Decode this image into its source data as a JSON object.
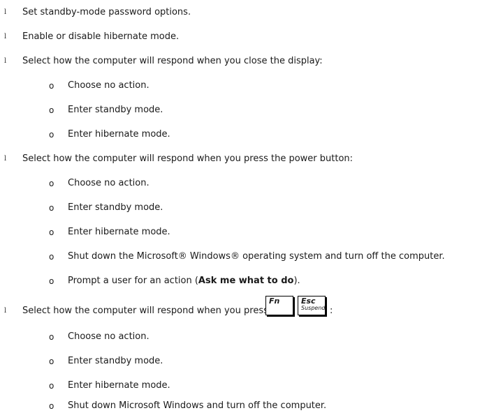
{
  "bullet_glyph": "l",
  "sub_bullet_glyph": "o",
  "items": [
    {
      "text": "Set standby-mode password options."
    },
    {
      "text": "Enable or disable hibernate mode."
    },
    {
      "text": "Select how the computer will respond when you close the display:"
    },
    {
      "sub": [
        "Choose no action.",
        "Enter standby mode.",
        "Enter hibernate mode."
      ]
    },
    {
      "text": "Select how the computer will respond when you press the power button:"
    },
    {
      "sub": [
        "Choose no action.",
        "Enter standby mode.",
        "Enter hibernate mode.",
        "Shut down the Microsoft® Windows® operating system and turn off the computer."
      ]
    },
    {
      "prompt_before": "Prompt a user for an action (",
      "prompt_bold": "Ask me what to do",
      "prompt_after": ")."
    },
    {
      "text_keys": "Select how the computer will respond when you press",
      "key_fn": "Fn",
      "key_esc_top": "Esc",
      "key_esc_bottom": "Suspend",
      "after_keys": ":"
    },
    {
      "sub2": [
        "Choose no action.",
        "Enter standby mode.",
        "Enter hibernate mode.",
        "Shut down Microsoft Windows and turn off the computer."
      ]
    }
  ]
}
